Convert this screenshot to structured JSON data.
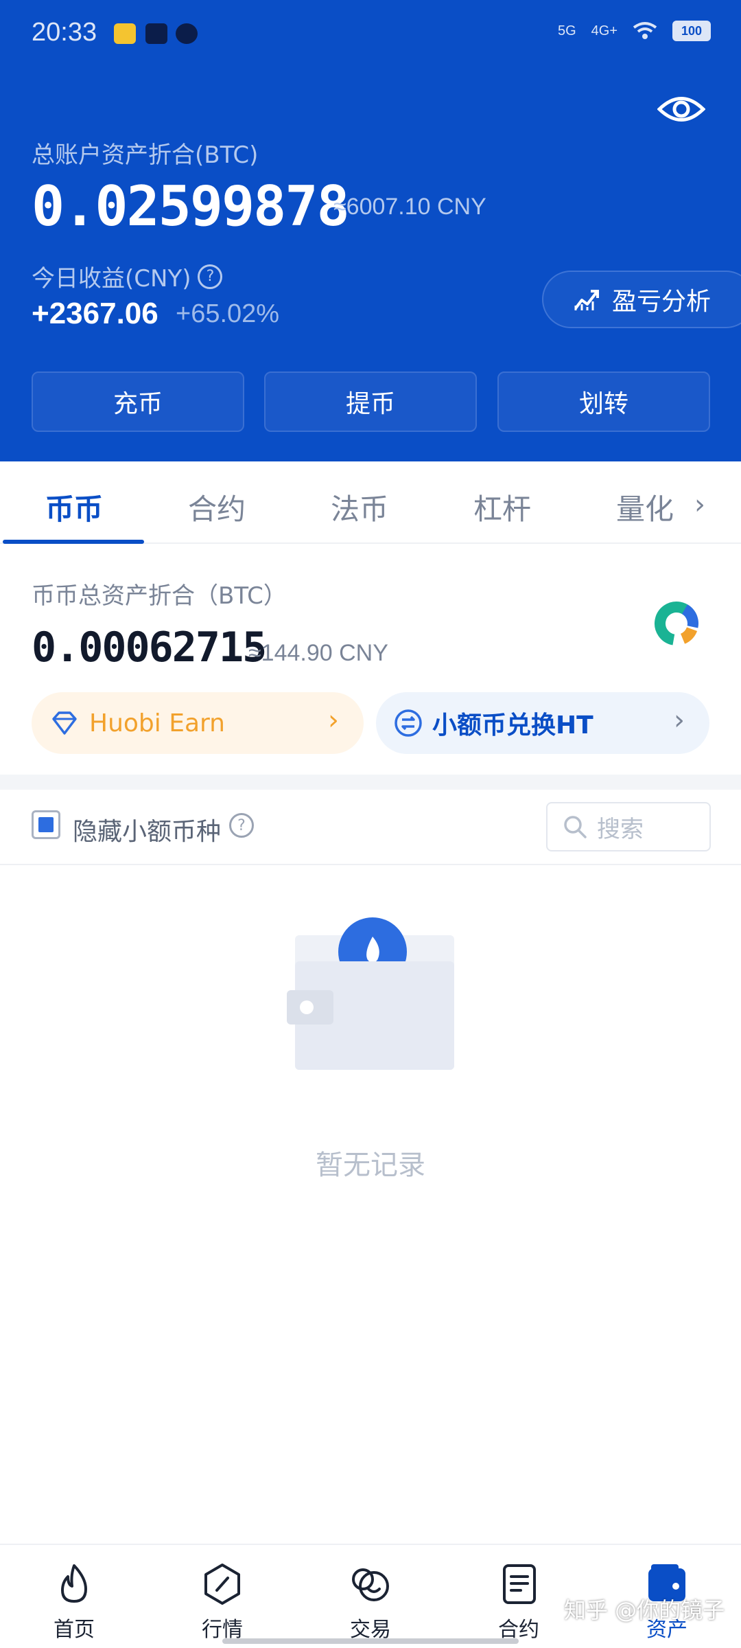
{
  "status_bar": {
    "time": "20:33",
    "signal_1": "5G",
    "signal_2": "4G+",
    "battery": "100"
  },
  "account": {
    "total_label": "总账户资产折合(BTC)",
    "total_value": "0.02599878",
    "total_approx": "≈6007.10 CNY",
    "today_label": "今日收益(CNY)",
    "today_value": "+2367.06",
    "today_percent": "+65.02%",
    "pl_analysis_label": "盈亏分析"
  },
  "actions": [
    {
      "label": "充币"
    },
    {
      "label": "提币"
    },
    {
      "label": "划转"
    }
  ],
  "tabs": [
    {
      "label": "币币",
      "active": true
    },
    {
      "label": "合约",
      "active": false
    },
    {
      "label": "法币",
      "active": false
    },
    {
      "label": "杠杆",
      "active": false
    },
    {
      "label": "量化",
      "active": false
    }
  ],
  "spot": {
    "label": "币币总资产折合（BTC）",
    "value": "0.00062715",
    "approx": "≈144.90 CNY"
  },
  "promos": {
    "earn_label": "Huobi Earn",
    "convert_label": "小额币兑换HT"
  },
  "filter": {
    "hide_small_label": "隐藏小额币种",
    "hide_small_checked": true,
    "search_placeholder": "搜索"
  },
  "empty_state": {
    "text": "暂无记录"
  },
  "bottom_nav": [
    {
      "label": "首页",
      "icon": "flame-icon",
      "active": false
    },
    {
      "label": "行情",
      "icon": "market-icon",
      "active": false
    },
    {
      "label": "交易",
      "icon": "trade-icon",
      "active": false
    },
    {
      "label": "合约",
      "icon": "contract-icon",
      "active": false
    },
    {
      "label": "资产",
      "icon": "wallet-icon",
      "active": true
    }
  ],
  "watermark": "知乎 @你的镜子",
  "colors": {
    "brand_blue": "#0a4ec6",
    "earn_orange": "#f2a12c",
    "muted_text": "#7a8497"
  }
}
